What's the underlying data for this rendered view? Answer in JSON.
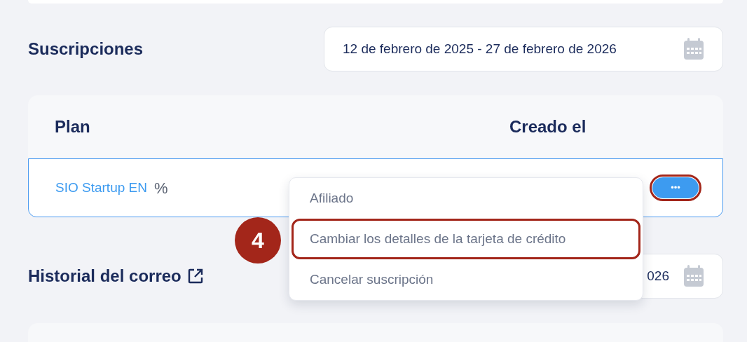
{
  "subscriptions": {
    "title": "Suscripciones",
    "date_range": {
      "value": "12 de febrero de 2025 - 27 de febrero de 2026"
    },
    "table": {
      "columns": [
        "Plan",
        "Creado el"
      ],
      "rows": [
        {
          "plan": "SIO Startup EN",
          "plan_icon": "%",
          "actions_button": {
            "label": "•••",
            "highlighted": true
          }
        }
      ]
    }
  },
  "row_menu": {
    "items": [
      {
        "label": "Afiliado",
        "highlighted": false
      },
      {
        "label": "Cambiar los detalles de la tarjeta de crédito",
        "highlighted": true
      },
      {
        "label": "Cancelar suscripción",
        "highlighted": false
      }
    ]
  },
  "callout": {
    "label": "4"
  },
  "email_history": {
    "title": "Historial del correo",
    "date_range": {
      "value": "026"
    }
  }
}
